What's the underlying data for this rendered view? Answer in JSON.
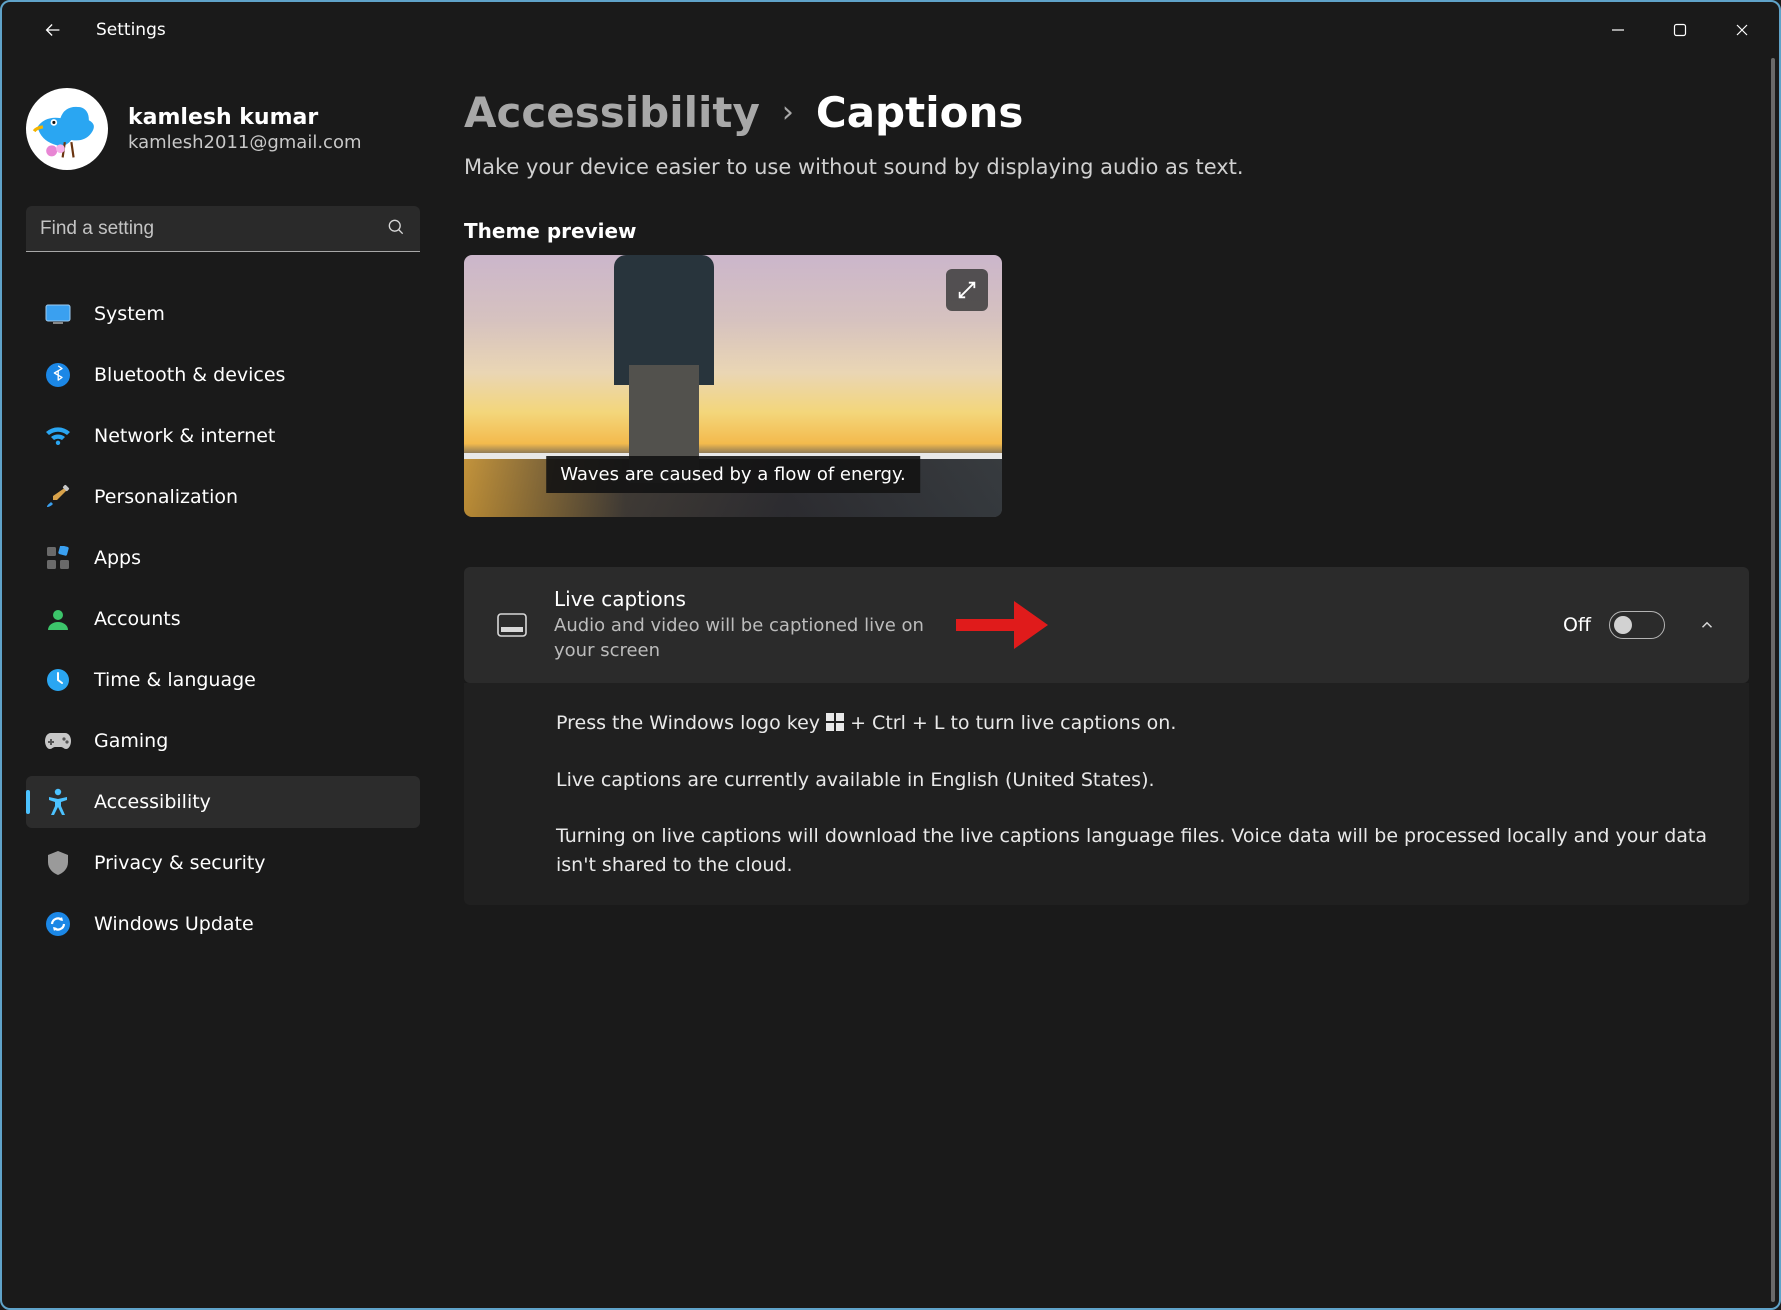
{
  "window": {
    "title": "Settings"
  },
  "user": {
    "name": "kamlesh kumar",
    "email": "kamlesh2011@gmail.com"
  },
  "search": {
    "placeholder": "Find a setting"
  },
  "sidebar": {
    "items": [
      {
        "label": "System"
      },
      {
        "label": "Bluetooth & devices"
      },
      {
        "label": "Network & internet"
      },
      {
        "label": "Personalization"
      },
      {
        "label": "Apps"
      },
      {
        "label": "Accounts"
      },
      {
        "label": "Time & language"
      },
      {
        "label": "Gaming"
      },
      {
        "label": "Accessibility"
      },
      {
        "label": "Privacy & security"
      },
      {
        "label": "Windows Update"
      }
    ]
  },
  "breadcrumb": {
    "parent": "Accessibility",
    "sep": "›",
    "current": "Captions"
  },
  "subtitle": "Make your device easier to use without sound by displaying audio as text.",
  "theme_preview": {
    "heading": "Theme preview",
    "caption_sample": "Waves are caused by a flow of energy."
  },
  "live_captions": {
    "title": "Live captions",
    "description": "Audio and video will be captioned live on your screen",
    "toggle_text": "Off"
  },
  "info": {
    "line1_pre": "Press the Windows logo key ",
    "line1_post": " + Ctrl + L to turn live captions on.",
    "line2": "Live captions are currently available in English (United States).",
    "line3": "Turning on live captions will download the live captions language files. Voice data will be processed locally and your data isn't shared to the cloud."
  }
}
